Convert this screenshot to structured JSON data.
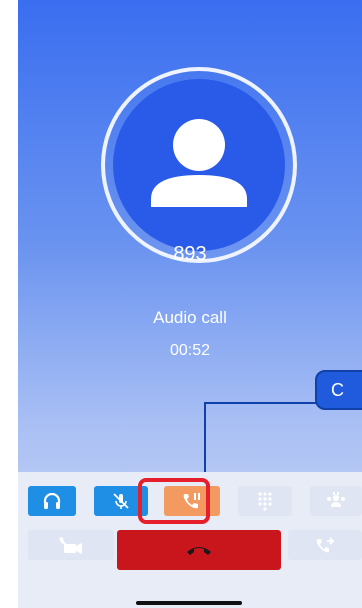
{
  "contact": {
    "number": "893"
  },
  "call": {
    "type": "Audio call",
    "duration": "00:52"
  },
  "callout": {
    "text": "C"
  },
  "controls": {
    "row1": [
      "headset-icon",
      "mic-muted-icon",
      "hold-icon",
      "dialpad-icon",
      "conference-icon"
    ],
    "row2": [
      "video-icon",
      "end-call-icon",
      "transfer-icon"
    ]
  },
  "colors": {
    "accent_blue": "#1f8fe5",
    "hold_orange": "#f39a61",
    "end_call_red": "#c8161c",
    "highlight_red": "#e51f2b",
    "callout_blue": "#1f5bdc"
  }
}
